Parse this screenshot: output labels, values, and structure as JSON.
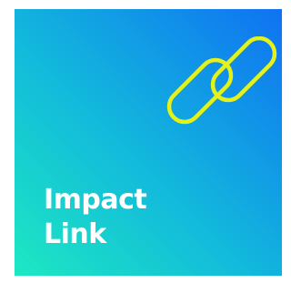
{
  "tile": {
    "title_line1": "Impact",
    "title_line2": "Link",
    "icon": "chain-link-icon"
  },
  "colors": {
    "gradient_start": "#1de8c2",
    "gradient_mid": "#12b9dc",
    "gradient_end": "#0f72f2",
    "icon_stroke": "#e4f21a",
    "text": "#ffffff"
  }
}
